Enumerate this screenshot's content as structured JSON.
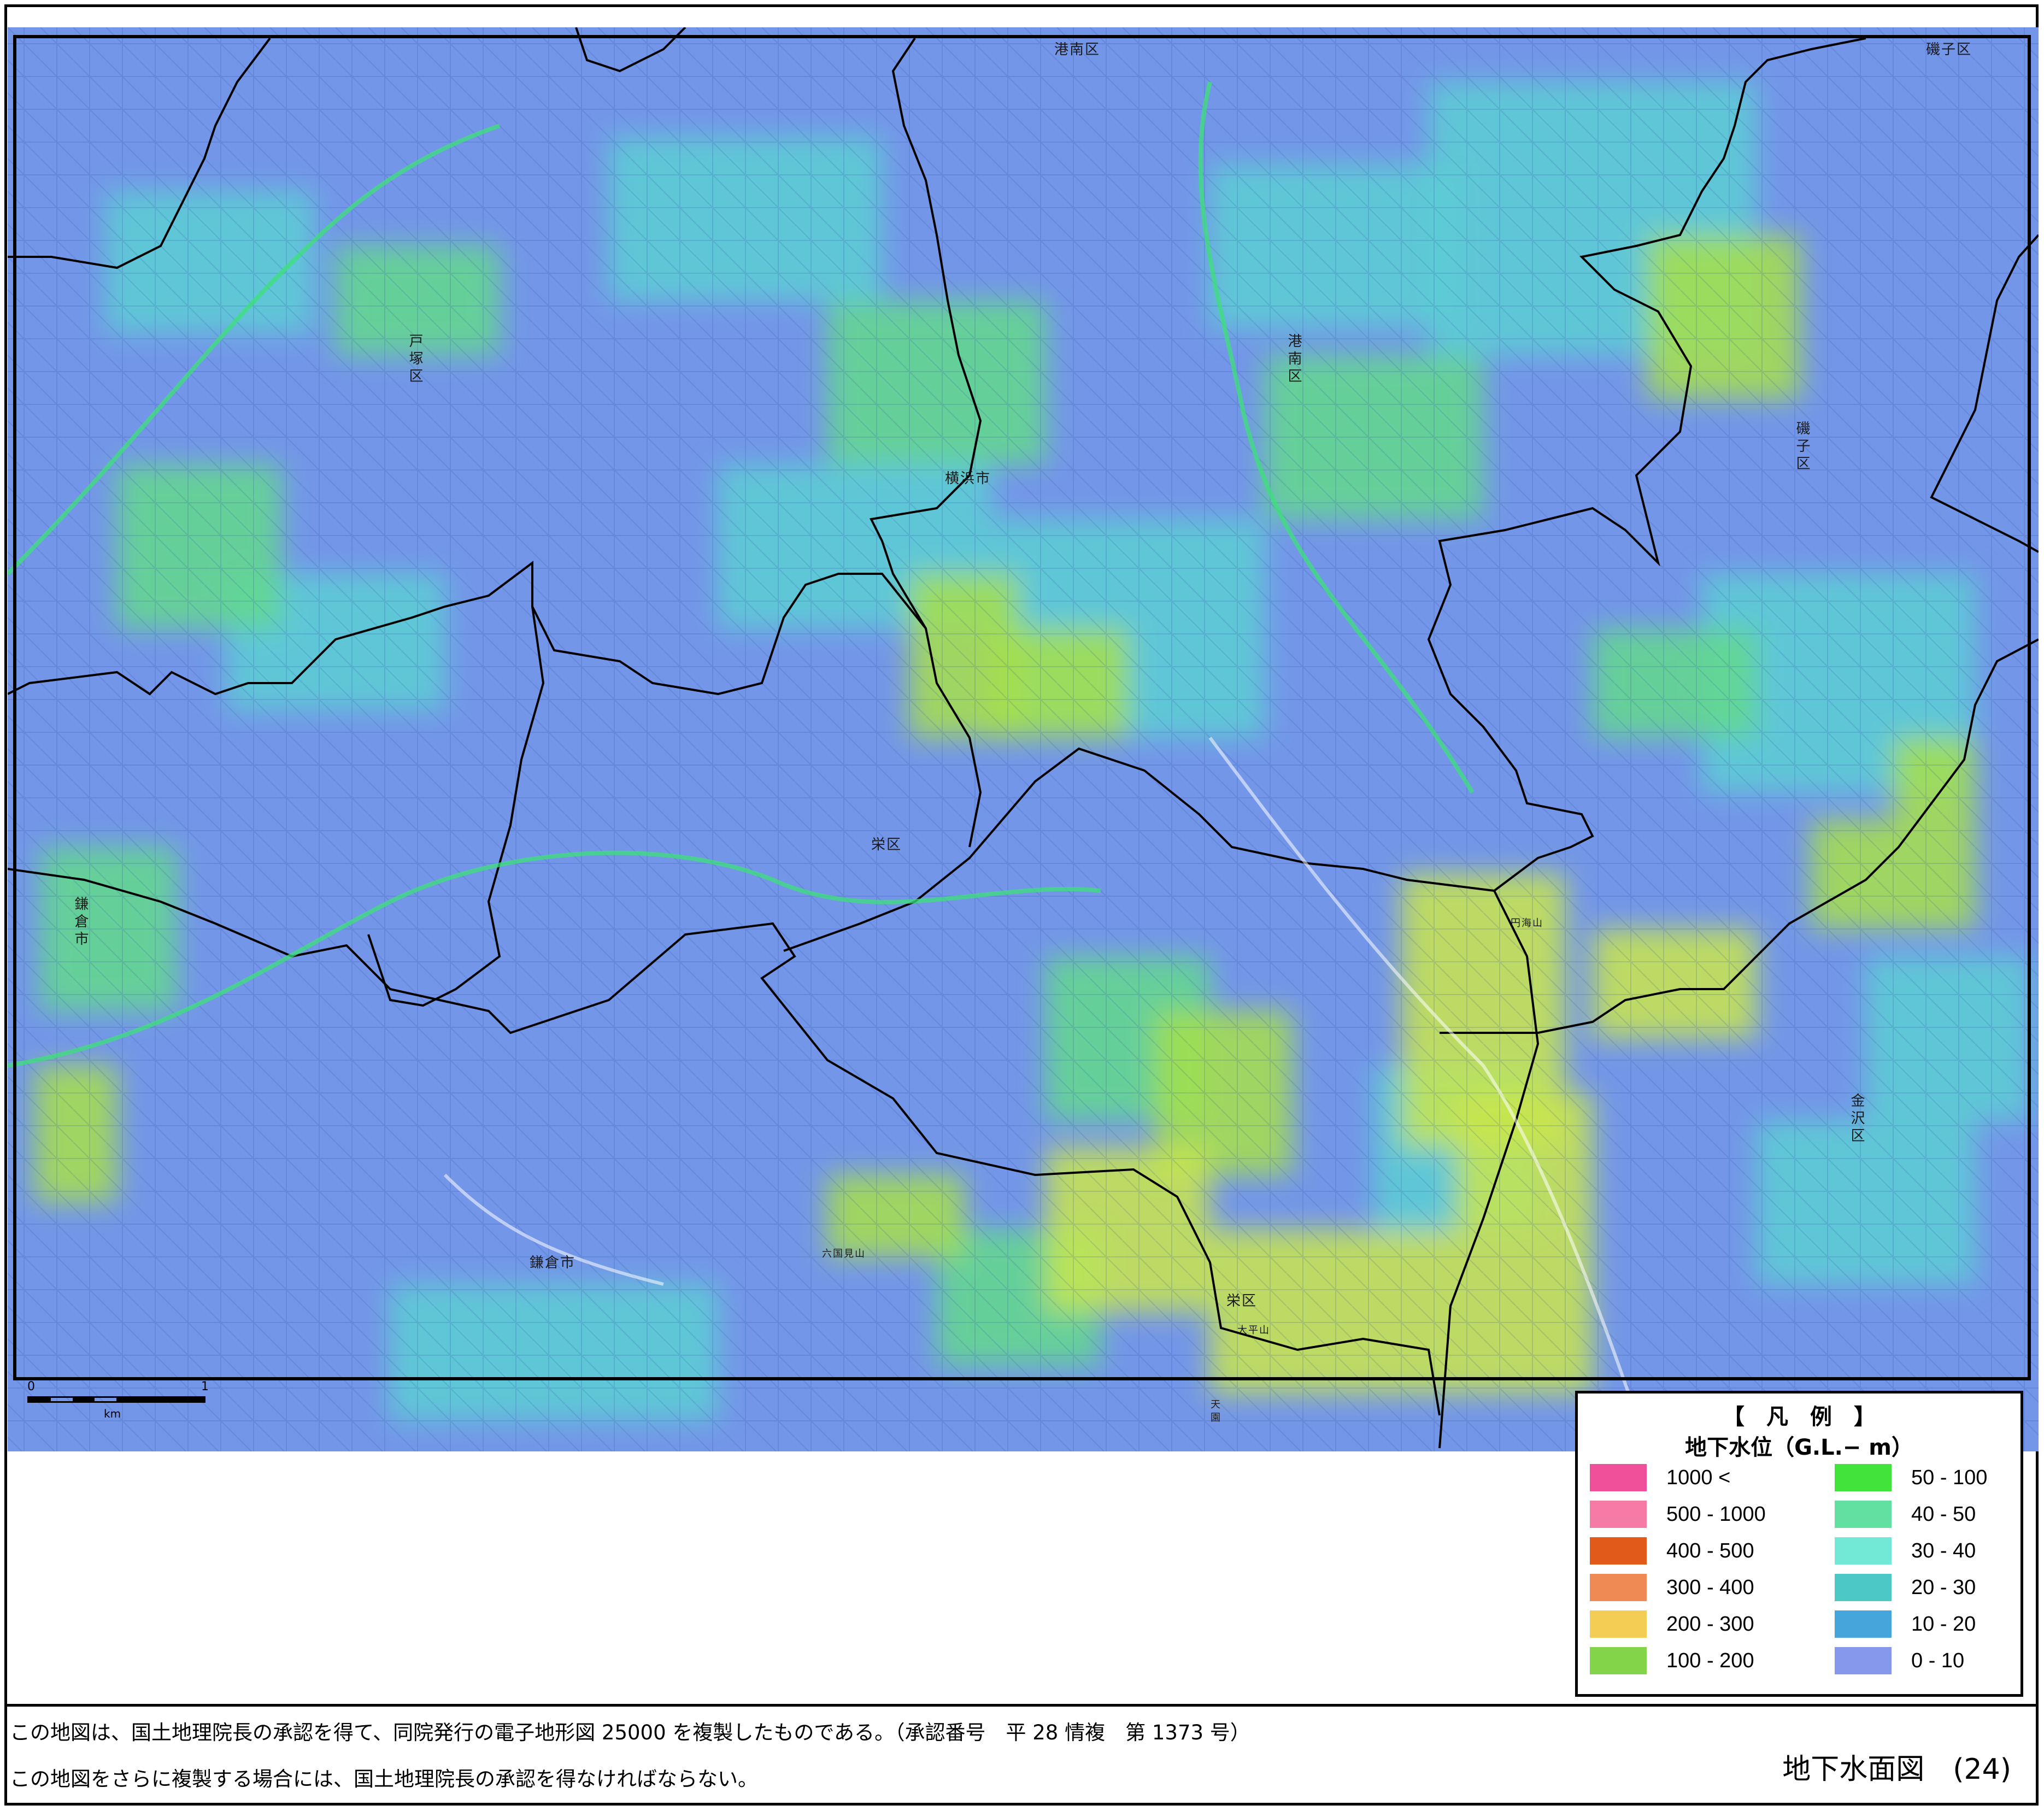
{
  "map": {
    "labels": {
      "konan_top": "港南区",
      "isogo_top": "磯子区",
      "totsuka": "戸塚区",
      "konan_mid": "港南区",
      "yokohama": "横浜市",
      "isogo_right": "磯子区",
      "sakae_mid": "栄区",
      "kamakura_city_left": "鎌倉市",
      "kanazawa": "金沢区",
      "kamakura_city_bottom": "鎌倉市",
      "sakae_bottom": "栄区",
      "rokkokuken": "六国見山",
      "entsuzan": "円海山",
      "ohirayama": "大平山",
      "tenendai": "天園"
    },
    "scale": {
      "start": "0",
      "end": "1",
      "unit": "km"
    },
    "colors": {
      "base_blue": "#7396e8",
      "cyan": "#5ccfd4",
      "green": "#63d98c",
      "lime": "#a7e04a",
      "yellow_green": "#c9e64e"
    }
  },
  "legend": {
    "title": "【　凡　例　】",
    "subtitle": "地下水位（G.L.− m）",
    "items": [
      {
        "label": "1000 <",
        "color": "#f0509a"
      },
      {
        "label": "500 - 1000",
        "color": "#f57aa6"
      },
      {
        "label": "400 - 500",
        "color": "#e25a19"
      },
      {
        "label": "300 - 400",
        "color": "#ef8a55"
      },
      {
        "label": "200 - 300",
        "color": "#f4cd55"
      },
      {
        "label": "100 - 200",
        "color": "#84d449"
      },
      {
        "label": "50 - 100",
        "color": "#40e43a"
      },
      {
        "label": "40 - 50",
        "color": "#62e0a2"
      },
      {
        "label": "30 - 40",
        "color": "#72e8d6"
      },
      {
        "label": "20 - 30",
        "color": "#4cc8c6"
      },
      {
        "label": "10 - 20",
        "color": "#46a6dc"
      },
      {
        "label": "0 - 10",
        "color": "#8698ec"
      }
    ]
  },
  "footer": {
    "note1": "この地図は、国土地理院長の承認を得て、同院発行の電子地形図 25000 を複製したものである。（承認番号　平 28 情複　第 1373 号）",
    "note2": "この地図をさらに複製する場合には、国土地理院長の承認を得なければならない。",
    "sheet_title": "地下水面図　(24)"
  }
}
